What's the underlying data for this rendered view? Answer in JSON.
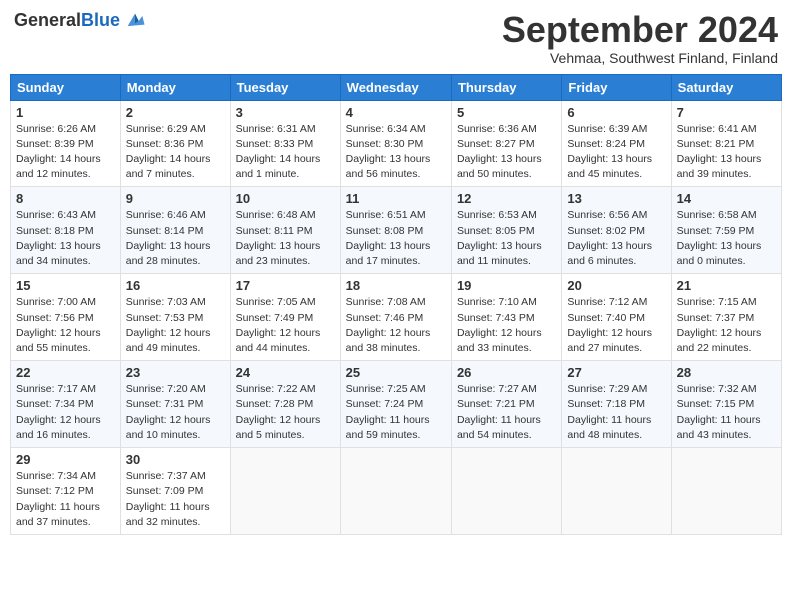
{
  "header": {
    "logo_general": "General",
    "logo_blue": "Blue",
    "month_title": "September 2024",
    "location": "Vehmaa, Southwest Finland, Finland"
  },
  "weekdays": [
    "Sunday",
    "Monday",
    "Tuesday",
    "Wednesday",
    "Thursday",
    "Friday",
    "Saturday"
  ],
  "weeks": [
    [
      {
        "day": "1",
        "sunrise": "6:26 AM",
        "sunset": "8:39 PM",
        "daylight": "14 hours and 12 minutes."
      },
      {
        "day": "2",
        "sunrise": "6:29 AM",
        "sunset": "8:36 PM",
        "daylight": "14 hours and 7 minutes."
      },
      {
        "day": "3",
        "sunrise": "6:31 AM",
        "sunset": "8:33 PM",
        "daylight": "14 hours and 1 minute."
      },
      {
        "day": "4",
        "sunrise": "6:34 AM",
        "sunset": "8:30 PM",
        "daylight": "13 hours and 56 minutes."
      },
      {
        "day": "5",
        "sunrise": "6:36 AM",
        "sunset": "8:27 PM",
        "daylight": "13 hours and 50 minutes."
      },
      {
        "day": "6",
        "sunrise": "6:39 AM",
        "sunset": "8:24 PM",
        "daylight": "13 hours and 45 minutes."
      },
      {
        "day": "7",
        "sunrise": "6:41 AM",
        "sunset": "8:21 PM",
        "daylight": "13 hours and 39 minutes."
      }
    ],
    [
      {
        "day": "8",
        "sunrise": "6:43 AM",
        "sunset": "8:18 PM",
        "daylight": "13 hours and 34 minutes."
      },
      {
        "day": "9",
        "sunrise": "6:46 AM",
        "sunset": "8:14 PM",
        "daylight": "13 hours and 28 minutes."
      },
      {
        "day": "10",
        "sunrise": "6:48 AM",
        "sunset": "8:11 PM",
        "daylight": "13 hours and 23 minutes."
      },
      {
        "day": "11",
        "sunrise": "6:51 AM",
        "sunset": "8:08 PM",
        "daylight": "13 hours and 17 minutes."
      },
      {
        "day": "12",
        "sunrise": "6:53 AM",
        "sunset": "8:05 PM",
        "daylight": "13 hours and 11 minutes."
      },
      {
        "day": "13",
        "sunrise": "6:56 AM",
        "sunset": "8:02 PM",
        "daylight": "13 hours and 6 minutes."
      },
      {
        "day": "14",
        "sunrise": "6:58 AM",
        "sunset": "7:59 PM",
        "daylight": "13 hours and 0 minutes."
      }
    ],
    [
      {
        "day": "15",
        "sunrise": "7:00 AM",
        "sunset": "7:56 PM",
        "daylight": "12 hours and 55 minutes."
      },
      {
        "day": "16",
        "sunrise": "7:03 AM",
        "sunset": "7:53 PM",
        "daylight": "12 hours and 49 minutes."
      },
      {
        "day": "17",
        "sunrise": "7:05 AM",
        "sunset": "7:49 PM",
        "daylight": "12 hours and 44 minutes."
      },
      {
        "day": "18",
        "sunrise": "7:08 AM",
        "sunset": "7:46 PM",
        "daylight": "12 hours and 38 minutes."
      },
      {
        "day": "19",
        "sunrise": "7:10 AM",
        "sunset": "7:43 PM",
        "daylight": "12 hours and 33 minutes."
      },
      {
        "day": "20",
        "sunrise": "7:12 AM",
        "sunset": "7:40 PM",
        "daylight": "12 hours and 27 minutes."
      },
      {
        "day": "21",
        "sunrise": "7:15 AM",
        "sunset": "7:37 PM",
        "daylight": "12 hours and 22 minutes."
      }
    ],
    [
      {
        "day": "22",
        "sunrise": "7:17 AM",
        "sunset": "7:34 PM",
        "daylight": "12 hours and 16 minutes."
      },
      {
        "day": "23",
        "sunrise": "7:20 AM",
        "sunset": "7:31 PM",
        "daylight": "12 hours and 10 minutes."
      },
      {
        "day": "24",
        "sunrise": "7:22 AM",
        "sunset": "7:28 PM",
        "daylight": "12 hours and 5 minutes."
      },
      {
        "day": "25",
        "sunrise": "7:25 AM",
        "sunset": "7:24 PM",
        "daylight": "11 hours and 59 minutes."
      },
      {
        "day": "26",
        "sunrise": "7:27 AM",
        "sunset": "7:21 PM",
        "daylight": "11 hours and 54 minutes."
      },
      {
        "day": "27",
        "sunrise": "7:29 AM",
        "sunset": "7:18 PM",
        "daylight": "11 hours and 48 minutes."
      },
      {
        "day": "28",
        "sunrise": "7:32 AM",
        "sunset": "7:15 PM",
        "daylight": "11 hours and 43 minutes."
      }
    ],
    [
      {
        "day": "29",
        "sunrise": "7:34 AM",
        "sunset": "7:12 PM",
        "daylight": "11 hours and 37 minutes."
      },
      {
        "day": "30",
        "sunrise": "7:37 AM",
        "sunset": "7:09 PM",
        "daylight": "11 hours and 32 minutes."
      },
      null,
      null,
      null,
      null,
      null
    ]
  ],
  "labels": {
    "sunrise": "Sunrise:",
    "sunset": "Sunset:",
    "daylight": "Daylight:"
  }
}
